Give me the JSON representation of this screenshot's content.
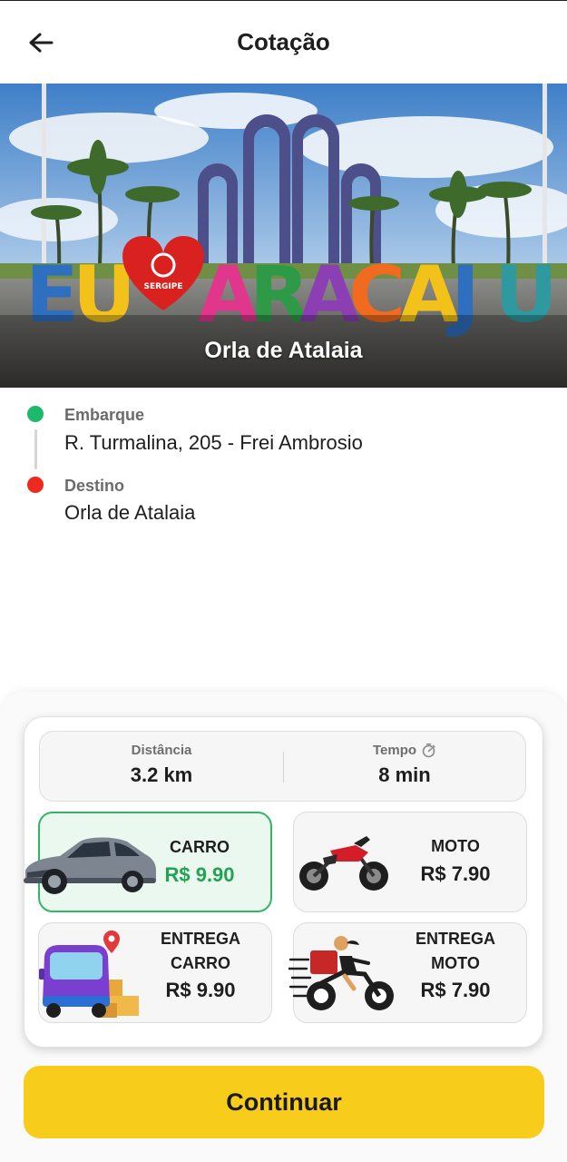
{
  "header": {
    "title": "Cotação"
  },
  "hero": {
    "caption": "Orla de Atalaia",
    "sign_letters": "EU ARACAJU",
    "heart_text": "SERGIPE"
  },
  "route": {
    "origin_label": "Embarque",
    "origin_value": "R. Turmalina, 205 - Frei Ambrosio",
    "destination_label": "Destino",
    "destination_value": "Orla de Atalaia"
  },
  "stats": {
    "distance_label": "Distância",
    "distance_value": "3.2 km",
    "time_label": "Tempo",
    "time_value": "8 min"
  },
  "options": [
    {
      "name": "CARRO",
      "price": "R$ 9.90",
      "selected": true,
      "icon": "car-icon"
    },
    {
      "name": "MOTO",
      "price": "R$ 7.90",
      "selected": false,
      "icon": "motorcycle-icon"
    },
    {
      "name_line1": "ENTREGA",
      "name_line2": "CARRO",
      "price": "R$ 9.90",
      "selected": false,
      "icon": "delivery-van-icon"
    },
    {
      "name_line1": "ENTREGA",
      "name_line2": "MOTO",
      "price": "R$ 7.90",
      "selected": false,
      "icon": "delivery-moto-icon"
    }
  ],
  "actions": {
    "continue_label": "Continuar"
  },
  "colors": {
    "accent": "#f8cc1b",
    "selected": "#35b466",
    "price_selected": "#22a352",
    "origin_dot": "#1db86a",
    "destination_dot": "#ee2a1f"
  }
}
